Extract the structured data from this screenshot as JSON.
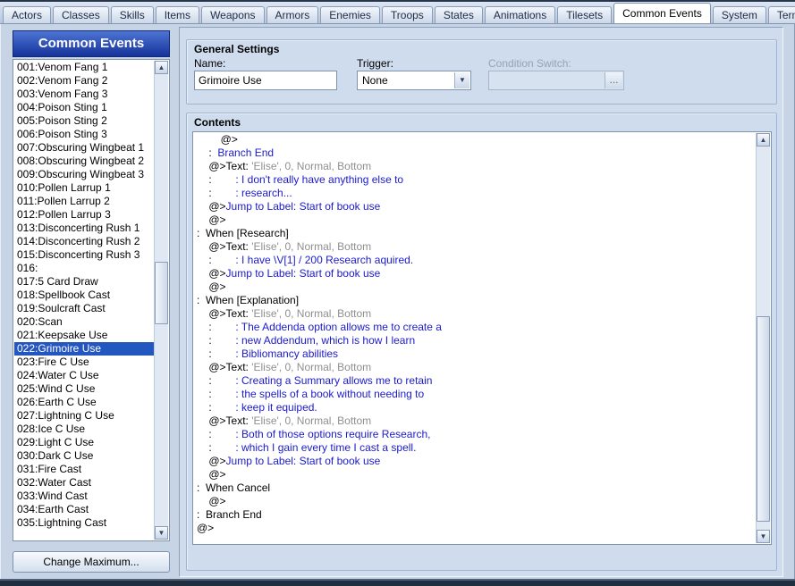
{
  "tabs": {
    "items": [
      "Actors",
      "Classes",
      "Skills",
      "Items",
      "Weapons",
      "Armors",
      "Enemies",
      "Troops",
      "States",
      "Animations",
      "Tilesets",
      "Common Events",
      "System",
      "Terms"
    ],
    "active": "Common Events"
  },
  "left": {
    "title": "Common Events",
    "events": [
      "001:Venom Fang 1",
      "002:Venom Fang 2",
      "003:Venom Fang 3",
      "004:Poison Sting 1",
      "005:Poison Sting 2",
      "006:Poison Sting 3",
      "007:Obscuring Wingbeat 1",
      "008:Obscuring Wingbeat 2",
      "009:Obscuring Wingbeat 3",
      "010:Pollen Larrup 1",
      "011:Pollen Larrup 2",
      "012:Pollen Larrup 3",
      "013:Disconcerting Rush 1",
      "014:Disconcerting Rush 2",
      "015:Disconcerting Rush 3",
      "016:",
      "017:5 Card Draw",
      "018:Spellbook Cast",
      "019:Soulcraft Cast",
      "020:Scan",
      "021:Keepsake Use",
      "022:Grimoire Use",
      "023:Fire C Use",
      "024:Water C Use",
      "025:Wind C Use",
      "026:Earth C Use",
      "027:Lightning C Use",
      "028:Ice C Use",
      "029:Light C Use",
      "030:Dark C Use",
      "031:Fire Cast",
      "032:Water Cast",
      "033:Wind Cast",
      "034:Earth Cast",
      "035:Lightning Cast"
    ],
    "selected": "022:Grimoire Use",
    "change_max_label": "Change Maximum..."
  },
  "general": {
    "title": "General Settings",
    "name_label": "Name:",
    "name_value": "Grimoire Use",
    "trigger_label": "Trigger:",
    "trigger_value": "None",
    "condition_label": "Condition Switch:",
    "condition_value": "",
    "ellipsis_label": "..."
  },
  "contents": {
    "title": "Contents",
    "lines": [
      [
        {
          "t": "        @>",
          "c": "k"
        }
      ],
      [
        {
          "t": "    :  ",
          "c": "k"
        },
        {
          "t": "Branch End",
          "c": "b"
        }
      ],
      [
        {
          "t": "    @>Text: ",
          "c": "k"
        },
        {
          "t": "'Elise', 0, Normal, Bottom",
          "c": "g"
        }
      ],
      [
        {
          "t": "    :        ",
          "c": "k"
        },
        {
          "t": ": I don't really have anything else to",
          "c": "b"
        }
      ],
      [
        {
          "t": "    :        ",
          "c": "k"
        },
        {
          "t": ": research...",
          "c": "b"
        }
      ],
      [
        {
          "t": "    @>",
          "c": "k"
        },
        {
          "t": "Jump to Label: Start of book use",
          "c": "b"
        }
      ],
      [
        {
          "t": "    @>",
          "c": "k"
        }
      ],
      [
        {
          "t": ":  When [Research]",
          "c": "k"
        }
      ],
      [
        {
          "t": "    @>Text: ",
          "c": "k"
        },
        {
          "t": "'Elise', 0, Normal, Bottom",
          "c": "g"
        }
      ],
      [
        {
          "t": "    :        ",
          "c": "k"
        },
        {
          "t": ": I have \\V[1] / 200 Research aquired.",
          "c": "b"
        }
      ],
      [
        {
          "t": "    @>",
          "c": "k"
        },
        {
          "t": "Jump to Label: Start of book use",
          "c": "b"
        }
      ],
      [
        {
          "t": "    @>",
          "c": "k"
        }
      ],
      [
        {
          "t": ":  When [Explanation]",
          "c": "k"
        }
      ],
      [
        {
          "t": "    @>Text: ",
          "c": "k"
        },
        {
          "t": "'Elise', 0, Normal, Bottom",
          "c": "g"
        }
      ],
      [
        {
          "t": "    :        ",
          "c": "k"
        },
        {
          "t": ": The Addenda option allows me to create a",
          "c": "b"
        }
      ],
      [
        {
          "t": "    :        ",
          "c": "k"
        },
        {
          "t": ": new Addendum, which is how I learn",
          "c": "b"
        }
      ],
      [
        {
          "t": "    :        ",
          "c": "k"
        },
        {
          "t": ": Bibliomancy abilities",
          "c": "b"
        }
      ],
      [
        {
          "t": "    @>Text: ",
          "c": "k"
        },
        {
          "t": "'Elise', 0, Normal, Bottom",
          "c": "g"
        }
      ],
      [
        {
          "t": "    :        ",
          "c": "k"
        },
        {
          "t": ": Creating a Summary allows me to retain",
          "c": "b"
        }
      ],
      [
        {
          "t": "    :        ",
          "c": "k"
        },
        {
          "t": ": the spells of a book without needing to",
          "c": "b"
        }
      ],
      [
        {
          "t": "    :        ",
          "c": "k"
        },
        {
          "t": ": keep it equiped.",
          "c": "b"
        }
      ],
      [
        {
          "t": "    @>Text: ",
          "c": "k"
        },
        {
          "t": "'Elise', 0, Normal, Bottom",
          "c": "g"
        }
      ],
      [
        {
          "t": "    :        ",
          "c": "k"
        },
        {
          "t": ": Both of those options require Research,",
          "c": "b"
        }
      ],
      [
        {
          "t": "    :        ",
          "c": "k"
        },
        {
          "t": ": which I gain every time I cast a spell.",
          "c": "b"
        }
      ],
      [
        {
          "t": "    @>",
          "c": "k"
        },
        {
          "t": "Jump to Label: Start of book use",
          "c": "b"
        }
      ],
      [
        {
          "t": "    @>",
          "c": "k"
        }
      ],
      [
        {
          "t": ":  When Cancel",
          "c": "k"
        }
      ],
      [
        {
          "t": "    @>",
          "c": "k"
        }
      ],
      [
        {
          "t": ":  Branch End",
          "c": "k"
        }
      ],
      [
        {
          "t": "@>",
          "c": "k"
        }
      ]
    ]
  },
  "icons": {
    "chevron_down": "▼",
    "scroll_up": "▲",
    "scroll_down": "▼"
  },
  "colors": {
    "selection": "#2456c0",
    "command_blue": "#1a1acd",
    "param_gray": "#8f8f8f",
    "title_top": "#4d74d4",
    "title_bottom": "#16339b"
  }
}
